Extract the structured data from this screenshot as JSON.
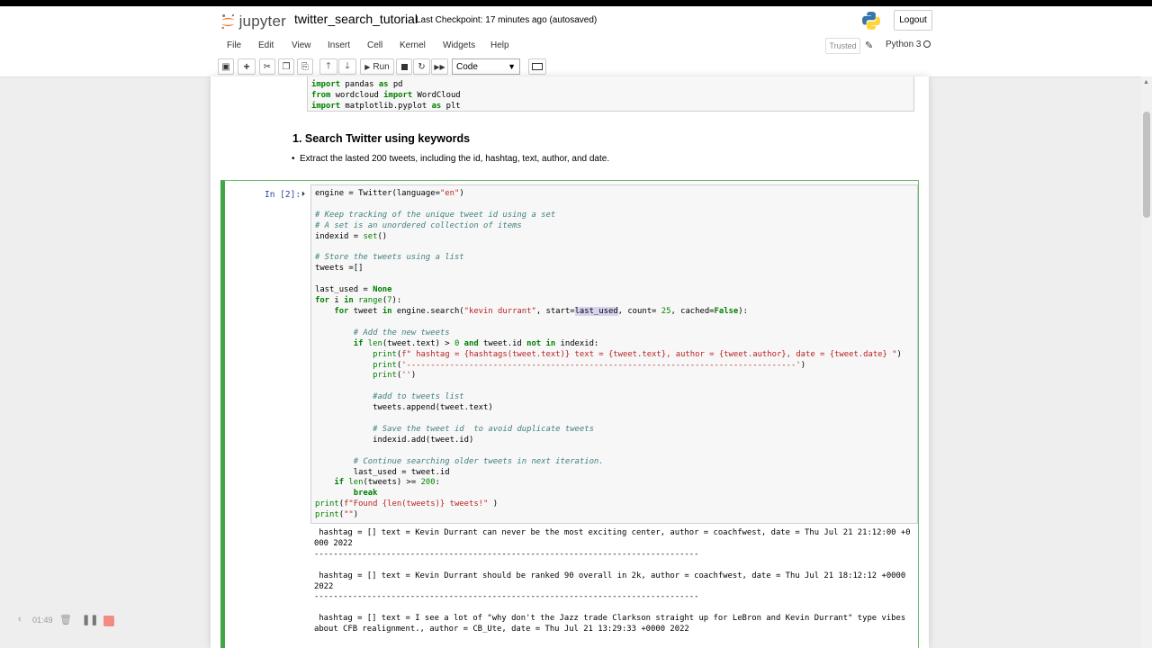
{
  "header": {
    "logo_text": "jupyter",
    "notebook_name": "twitter_search_tutorial",
    "checkpoint_label": "Last Checkpoint:",
    "checkpoint_time": "17 minutes ago",
    "autosave_status": "(autosaved)",
    "logout_label": "Logout"
  },
  "menu": {
    "items": [
      "File",
      "Edit",
      "View",
      "Insert",
      "Cell",
      "Kernel",
      "Widgets",
      "Help"
    ],
    "trusted_label": "Trusted",
    "kernel_name": "Python 3"
  },
  "toolbar": {
    "run_label": "Run",
    "cell_type": "Code",
    "icons": [
      "save-icon",
      "add-cell-icon",
      "cut-icon",
      "copy-icon",
      "paste-icon",
      "move-up-icon",
      "move-down-icon",
      "run-icon",
      "stop-icon",
      "restart-icon",
      "fast-forward-icon",
      "keyboard-icon"
    ]
  },
  "prev_cell": {
    "lines": [
      "import pandas as pd",
      "from wordcloud import WordCloud",
      "import matplotlib.pyplot as plt"
    ]
  },
  "markdown": {
    "heading": "1. Search Twitter using keywords",
    "bullet": "Extract the lasted 200 tweets, including the id, hashtag, text, author, and date."
  },
  "cell": {
    "prompt": "In [2]:",
    "code": "engine = Twitter(language=\"en\")\n\n# Keep tracking of the unique tweet id using a set\n# A set is an unordered collection of items\nindexid = set()\n\n# Store the tweets using a list\ntweets =[]\n\nlast_used = None\nfor i in range(7):\n    for tweet in engine.search(\"kevin durrant\", start=last_used, count= 25, cached=False):\n\n        # Add the new tweets\n        if len(tweet.text) > 0 and tweet.id not in indexid:\n            print(f\" hashtag = {hashtags(tweet.text)} text = {tweet.text}, author = {tweet.author}, date = {tweet.date} \")\n            print('---------------------------------------------------------------------------------')\n            print('')\n\n            #add to tweets list\n            tweets.append(tweet.text)\n\n            # Save the tweet id  to avoid duplicate tweets\n            indexid.add(tweet.id)\n\n        # Continue searching older tweets in next iteration.\n        last_used = tweet.id\n    if len(tweets) >= 200:\n        break\nprint(f\"Found {len(tweets)} tweets!\" )\nprint(\"\")",
    "output": " hashtag = [] text = Kevin Durrant can never be the most exciting center, author = coachfwest, date = Thu Jul 21 21:12:00 +0\n000 2022\n--------------------------------------------------------------------------------\n\n hashtag = [] text = Kevin Durrant should be ranked 90 overall in 2k, author = coachfwest, date = Thu Jul 21 18:12:12 +0000\n2022\n--------------------------------------------------------------------------------\n\n hashtag = [] text = I see a lot of \"why don't the Jazz trade Clarkson straight up for LeBron and Kevin Durrant\" type vibes\nabout CFB realignment., author = CB_Ute, date = Thu Jul 21 13:29:33 +0000 2022"
  },
  "recorder": {
    "time": "01:49"
  },
  "colors": {
    "selected_cell_border": "#42a548",
    "prompt": "#303f9f",
    "keyword": "#008000",
    "string": "#ba2121",
    "comment": "#408080"
  }
}
